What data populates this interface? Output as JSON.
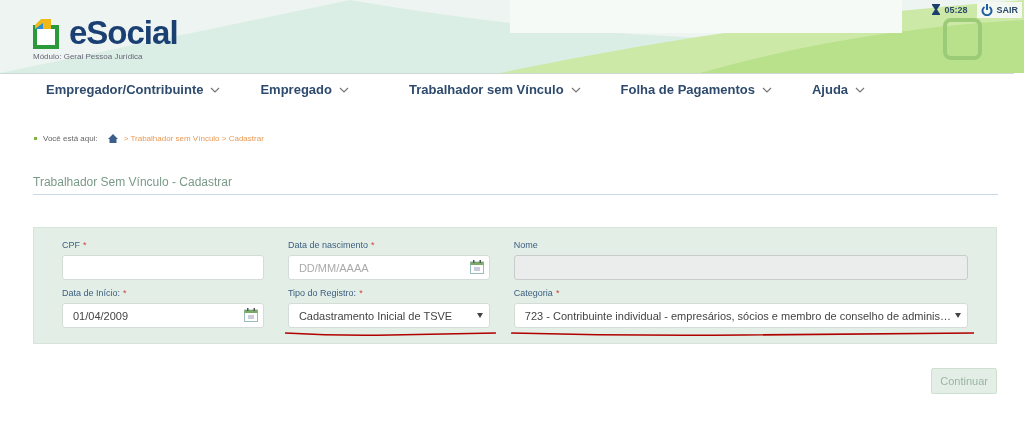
{
  "header": {
    "logo": "eSocial",
    "module": "Módulo: Geral Pessoa Jurídica",
    "timer": "05:28",
    "logout": "SAIR"
  },
  "menu": [
    {
      "label": "Empregador/Contribuinte"
    },
    {
      "label": "Empregado"
    },
    {
      "label": "Trabalhador sem Vínculo"
    },
    {
      "label": "Folha de Pagamentos"
    },
    {
      "label": "Ajuda"
    }
  ],
  "breadcrumb": {
    "prefix": "Você está aqui:",
    "path": "> Trabalhador sem Vínculo > Cadastrar"
  },
  "page_title": "Trabalhador Sem Vínculo - Cadastrar",
  "form": {
    "fields": [
      {
        "kind": "text",
        "label": "CPF",
        "required_mark": "*",
        "disabled": false
      },
      {
        "kind": "date",
        "label": "Data de nascimento",
        "required_mark": "*",
        "placeholder": "DD/MM/AAAA",
        "disabled": false
      },
      {
        "kind": "text",
        "label": "Nome",
        "disabled": true
      },
      {
        "kind": "date",
        "label": "Data de Início:",
        "required_mark": "*",
        "value": "01/04/2009",
        "disabled": false
      },
      {
        "kind": "select",
        "label": "Tipo do Registro:",
        "required_mark": "*",
        "value": "Cadastramento Inicial de TSVE",
        "disabled": false,
        "annotated": true
      },
      {
        "kind": "select",
        "label": "Categoria",
        "required_mark": "*",
        "value": "723 - Contribuinte individual - empresários, sócios e membro de conselho de adminis…",
        "disabled": false,
        "annotated": true
      }
    ]
  },
  "continue_button": {
    "label": "Continuar",
    "disabled": true
  }
}
